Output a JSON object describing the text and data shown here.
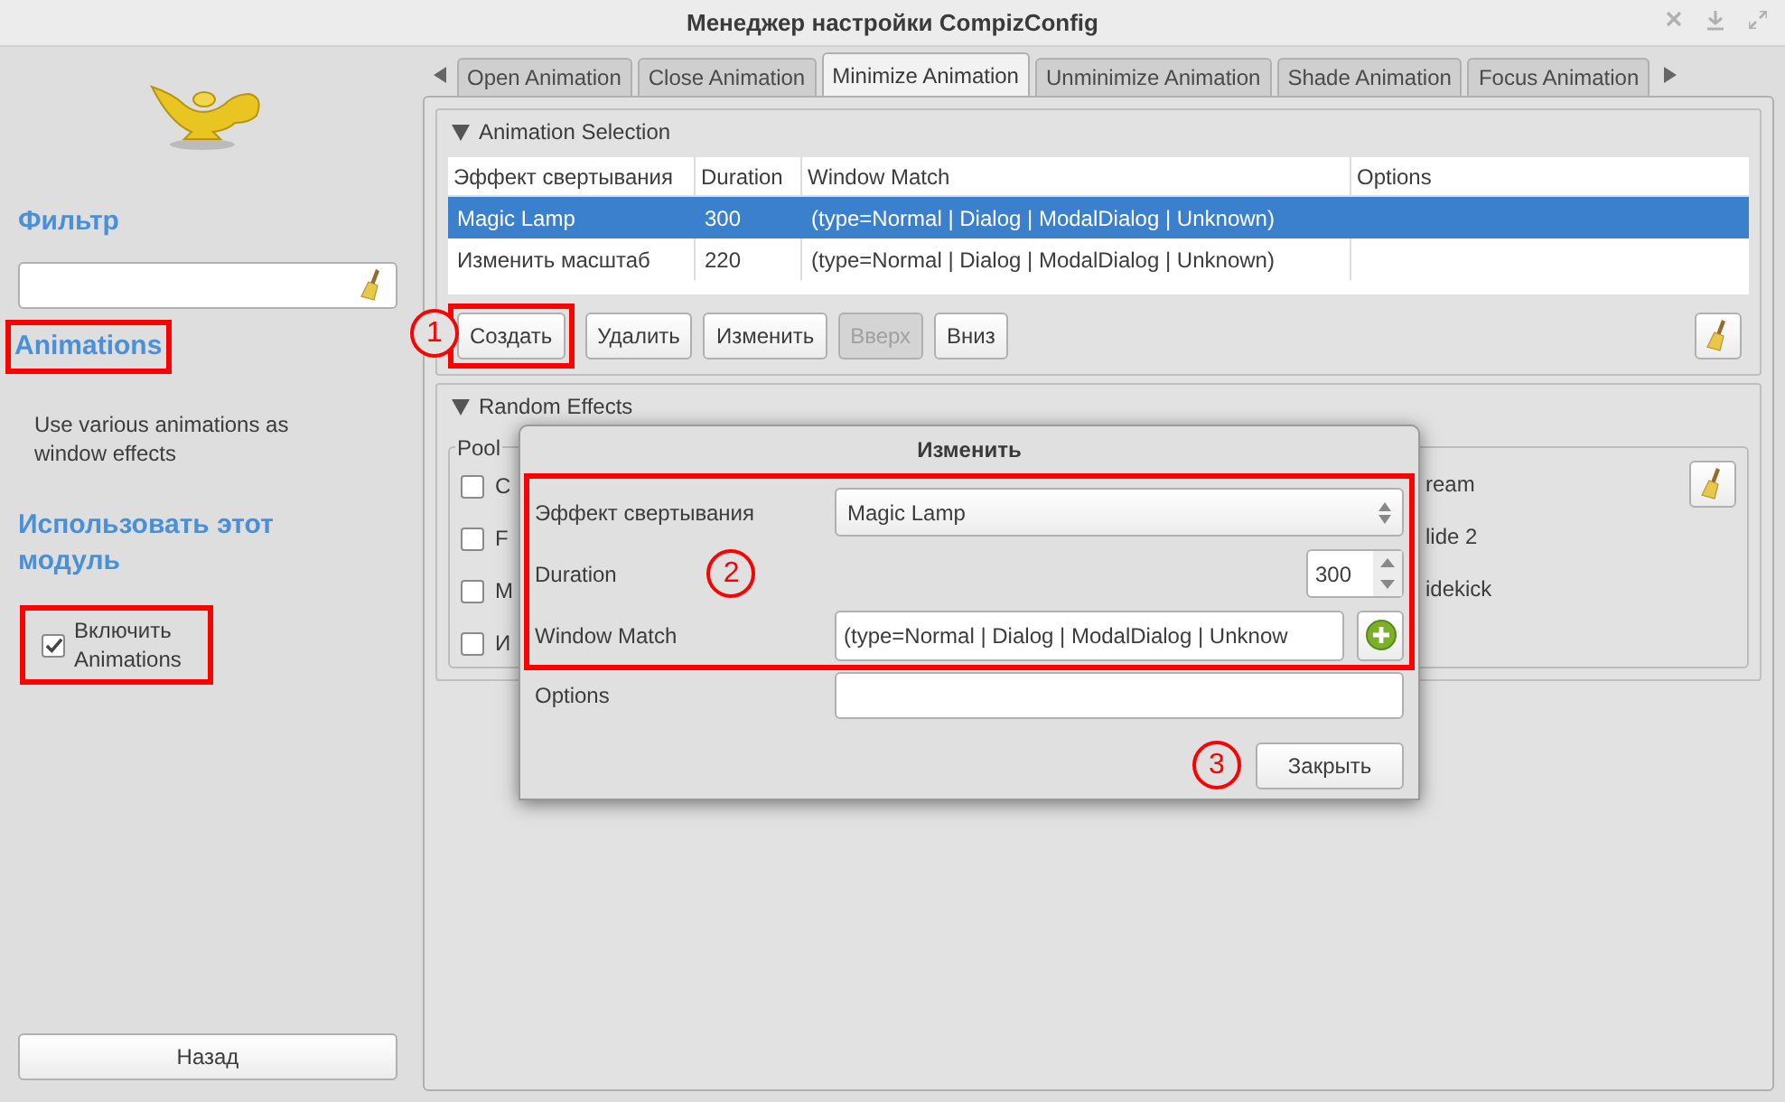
{
  "window": {
    "title": "Менеджер настройки CompizConfig"
  },
  "sidebar": {
    "filter_label": "Фильтр",
    "plugin_title": "Animations",
    "description": "Use various animations as window effects",
    "use_heading": "Использовать этот модуль",
    "enable": {
      "label": "Включить Animations",
      "checked": true
    },
    "back_button": "Назад"
  },
  "tabs": [
    {
      "label": "Open Animation",
      "selected": false
    },
    {
      "label": "Close Animation",
      "selected": false
    },
    {
      "label": "Minimize Animation",
      "selected": true
    },
    {
      "label": "Unminimize Animation",
      "selected": false
    },
    {
      "label": "Shade Animation",
      "selected": false
    },
    {
      "label": "Focus Animation",
      "selected": false
    }
  ],
  "animation_selection": {
    "title": "Animation Selection",
    "expanded": true,
    "columns": [
      "Эффект свертывания",
      "Duration",
      "Window Match",
      "Options"
    ],
    "rows": [
      {
        "cells": [
          "Magic Lamp",
          "300",
          "(type=Normal | Dialog | ModalDialog | Unknown)"
        ],
        "selected": true
      },
      {
        "cells": [
          "Изменить масштаб",
          "220",
          "(type=Normal | Dialog | ModalDialog | Unknown)"
        ],
        "selected": false
      }
    ],
    "buttons": [
      {
        "label": "Создать",
        "disabled": false
      },
      {
        "label": "Удалить",
        "disabled": false
      },
      {
        "label": "Изменить",
        "disabled": false
      },
      {
        "label": "Вверх",
        "disabled": true
      },
      {
        "label": "Вниз",
        "disabled": false
      }
    ]
  },
  "random_effects": {
    "title": "Random Effects",
    "expanded": true,
    "pool_label": "Pool",
    "left_items": [
      {
        "label": "C",
        "checked": false
      },
      {
        "label": "F",
        "checked": false
      },
      {
        "label": "M",
        "checked": false
      },
      {
        "label": "И",
        "checked": false
      }
    ],
    "right_items": [
      "ream",
      "lide 2",
      "idekick"
    ]
  },
  "dialog": {
    "title": "Изменить",
    "effect": {
      "label": "Эффект свертывания",
      "value": "Magic Lamp"
    },
    "duration": {
      "label": "Duration",
      "value": "300"
    },
    "window_match": {
      "label": "Window Match",
      "value": "(type=Normal | Dialog | ModalDialog | Unknow"
    },
    "options": {
      "label": "Options"
    },
    "close_button": "Закрыть"
  },
  "annotations": [
    "1",
    "2",
    "3"
  ]
}
